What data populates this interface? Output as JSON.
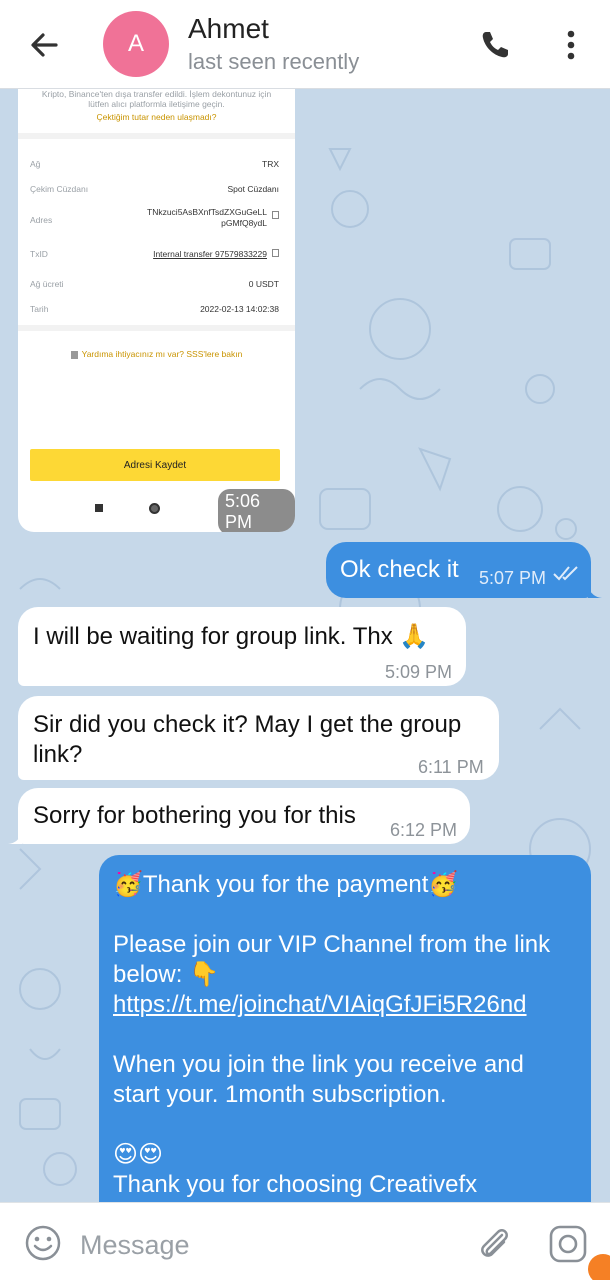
{
  "header": {
    "avatar_letter": "A",
    "name": "Ahmet",
    "status": "last seen recently",
    "avatar_color": "#f07297"
  },
  "screenshot": {
    "notice_line1": "Kripto, Binance'ten dışa transfer edildi. İşlem dekontunuz için",
    "notice_line2": "lütfen alıcı platformla iletişime geçin.",
    "notice_link": "Çektiğim tutar neden ulaşmadı?",
    "rows": [
      {
        "label": "Ağ",
        "value": "TRX"
      },
      {
        "label": "Çekim Cüzdanı",
        "value": "Spot Cüzdanı"
      },
      {
        "label": "Adres",
        "value": "TNkzuci5AsBXnfTsdZXGuGeLL pGMfQ8ydL"
      },
      {
        "label": "TxID",
        "value": "Internal transfer 97579833229"
      },
      {
        "label": "Ağ ücreti",
        "value": "0 USDT"
      },
      {
        "label": "Tarih",
        "value": "2022-02-13 14:02:38"
      }
    ],
    "help_text": "Yardıma ihtiyacınız mı var? SSS'lere bakın",
    "save_button": "Adresi Kaydet",
    "time": "5:06 PM"
  },
  "messages": [
    {
      "dir": "out",
      "text": "Ok check it",
      "time": "5:07 PM",
      "read": true
    },
    {
      "dir": "in",
      "text": "I will be waiting for group link. Thx 🙏",
      "time": "5:09 PM"
    },
    {
      "dir": "in",
      "text_line1": "Sir did you check it? May I get the group",
      "text_line2": "link?",
      "time": "6:11 PM"
    },
    {
      "dir": "in",
      "text": "Sorry for bothering you for this",
      "time": "6:12 PM"
    },
    {
      "dir": "out",
      "line1": "🥳Thank you for the payment🥳",
      "line2": "Please join our VIP Channel from the link",
      "line3": "below: 👇",
      "link": "https://t.me/joinchat/VIAiqGfJFi5R26nd",
      "line4": "When you join the link you receive and",
      "line5": "start your. 1month subscription.",
      "line6": "😍😍",
      "line7": "Thank you for choosing Creativefx"
    }
  ],
  "composer": {
    "placeholder": "Message"
  },
  "icons": {
    "back": "back-arrow-icon",
    "call": "phone-icon",
    "menu": "more-vertical-icon",
    "emoji": "emoji-icon",
    "attach": "paperclip-icon",
    "camera": "camera-icon"
  },
  "colors": {
    "outgoing_bubble": "#3d8fe0",
    "incoming_bubble": "#ffffff",
    "wallpaper": "#c6d8e9",
    "save_button": "#fdd835"
  }
}
